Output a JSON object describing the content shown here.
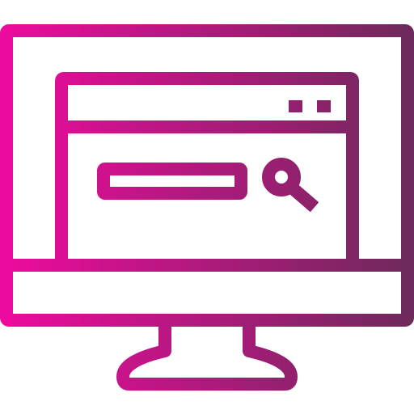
{
  "icon": {
    "name": "monitor-browser-search-icon",
    "gradient_start": "#ee0a9e",
    "gradient_end": "#6d2a5a"
  }
}
